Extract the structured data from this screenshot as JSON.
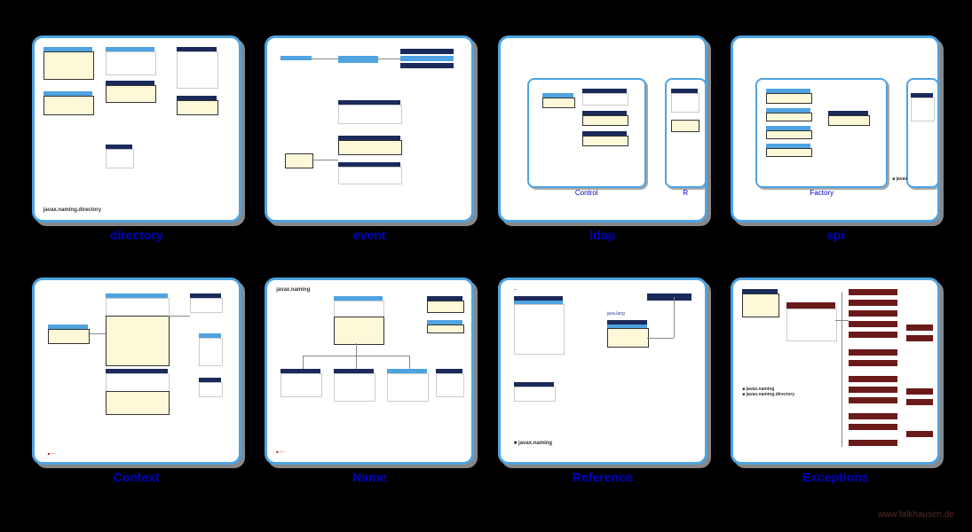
{
  "footer": "www.falkhausen.de",
  "panels": [
    {
      "label": "directory",
      "pkg": "javax.naming.directory"
    },
    {
      "label": "event",
      "pkg": ""
    },
    {
      "label": "ldap",
      "pkg": "",
      "inner": [
        "Control",
        "R"
      ]
    },
    {
      "label": "spi",
      "pkg": "",
      "inner": [
        "Factory",
        ""
      ]
    },
    {
      "label": "Context",
      "pkg": ""
    },
    {
      "label": "Name",
      "pkg": "javax.naming"
    },
    {
      "label": "Reference",
      "pkg": "javax.naming"
    },
    {
      "label": "Exceptions",
      "pkg": "javax.naming, javax.naming.directory"
    }
  ]
}
